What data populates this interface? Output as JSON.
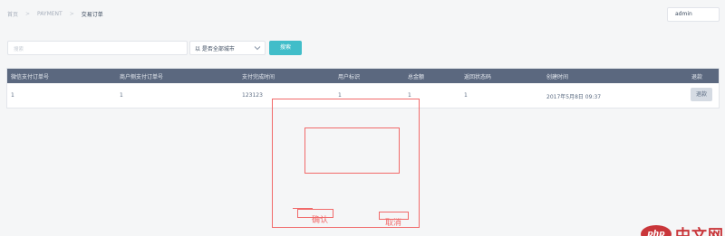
{
  "breadcrumb": {
    "items": [
      "首页",
      "PAYMENT",
      "交易订单"
    ],
    "separator": ">"
  },
  "user": {
    "name": "admin"
  },
  "filters": {
    "search_placeholder": "搜索",
    "select_value": "以 是否全部城市",
    "search_button": "搜索"
  },
  "table": {
    "columns": [
      "微信支付订单号",
      "商户侧支付订单号",
      "支付完成时间",
      "用户标识",
      "总金额",
      "返回状态码",
      "创建时间",
      "退款"
    ],
    "rows": [
      {
        "wx_order": "1",
        "merchant_order": "1",
        "paid_time": "123123",
        "user_id": "1",
        "amount": "1",
        "status_code": "1",
        "created": "2017年5月8日 09:37",
        "action": "退款"
      }
    ]
  },
  "annotation": {
    "confirm": "确认",
    "cancel": "取消"
  },
  "watermark": {
    "logo": "php",
    "text": "中文网"
  },
  "colors": {
    "header_bg": "#5b687f",
    "accent": "#41bdc9",
    "annotation": "#f16a6a"
  }
}
